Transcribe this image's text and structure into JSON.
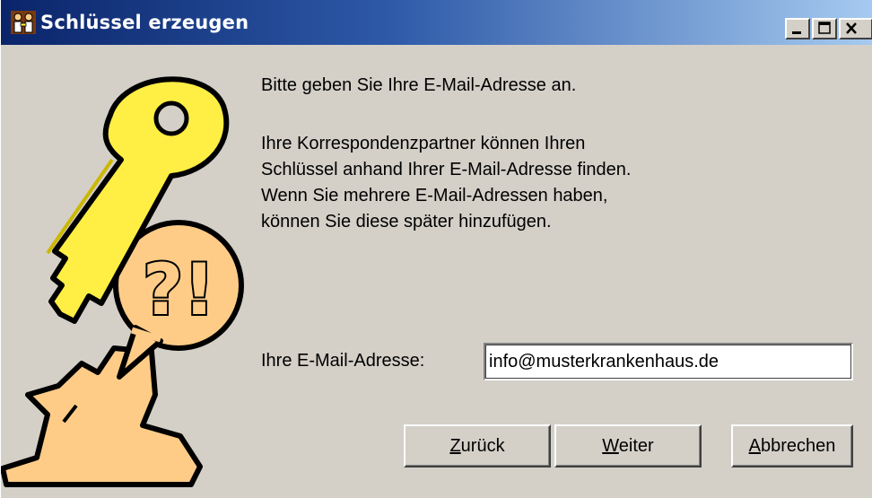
{
  "window": {
    "title": "Schlüssel erzeugen",
    "controls": {
      "minimize_icon": "minimize-icon",
      "maximize_icon": "maximize-icon",
      "close_icon": "close-icon"
    }
  },
  "content": {
    "intro": "Bitte geben Sie Ihre E-Mail-Adresse an.",
    "paragraph_lines": [
      "Ihre Korrespondenzpartner können Ihren",
      "Schlüssel anhand Ihrer E-Mail-Adresse finden.",
      "Wenn Sie mehrere E-Mail-Adressen haben,",
      "können Sie diese später hinzufügen."
    ]
  },
  "email": {
    "label": "Ihre E-Mail-Adresse:",
    "value": "info@musterkrankenhaus.de"
  },
  "buttons": {
    "back": "Zurück",
    "next": "Weiter",
    "cancel": "Abbrechen"
  },
  "colors": {
    "title_gradient_start": "#0a246a",
    "title_gradient_end": "#a6caf0",
    "dialog_bg": "#d4d0c8",
    "key_yellow": "#ffee44",
    "bubble_orange": "#ffcc88"
  }
}
